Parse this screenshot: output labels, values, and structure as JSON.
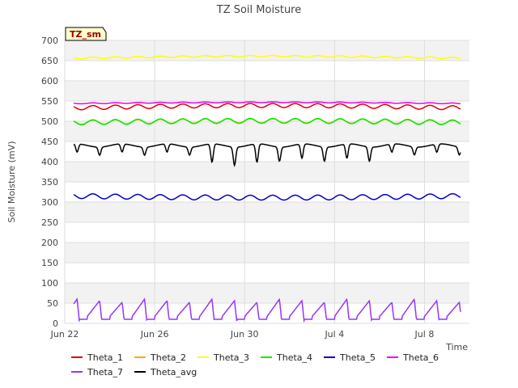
{
  "chart_data": {
    "type": "line",
    "title": "TZ Soil Moisture",
    "xlabel": "Time",
    "ylabel": "Soil Moisture (mV)",
    "badge": "TZ_sm",
    "ylim": [
      0,
      700
    ],
    "yticks": [
      0,
      50,
      100,
      150,
      200,
      250,
      300,
      350,
      400,
      450,
      500,
      550,
      600,
      650,
      700
    ],
    "xlim_days": [
      0,
      18
    ],
    "xticks": [
      {
        "label": "Jun 22",
        "day": 0
      },
      {
        "label": "Jun 26",
        "day": 4
      },
      {
        "label": "Jun 30",
        "day": 8
      },
      {
        "label": "Jul 4",
        "day": 12
      },
      {
        "label": "Jul 8",
        "day": 16
      }
    ],
    "data_range_days": [
      0.4,
      17.6
    ],
    "grid": true,
    "legend_position": "bottom",
    "series": [
      {
        "name": "Theta_1",
        "color": "#dd0000",
        "base": 533,
        "amp": 5,
        "trend": 6
      },
      {
        "name": "Theta_2",
        "color": "#ffaa00",
        "base": 497,
        "amp": 5,
        "trend": 4
      },
      {
        "name": "Theta_3",
        "color": "#ffff00",
        "base": 656,
        "amp": 2,
        "trend": 5
      },
      {
        "name": "Theta_4",
        "color": "#00ee00",
        "base": 497,
        "amp": 6,
        "trend": 4
      },
      {
        "name": "Theta_5",
        "color": "#0000cc",
        "base": 315,
        "amp": 6,
        "trend": -4
      },
      {
        "name": "Theta_6",
        "color": "#ee00ee",
        "base": 544,
        "amp": 1,
        "trend": 3
      },
      {
        "name": "Theta_7",
        "color": "#9933ff",
        "pattern": "sawtooth",
        "min": 5,
        "max": 60
      },
      {
        "name": "Theta_avg",
        "color": "#000000",
        "pattern": "dips",
        "high": 440,
        "low": 405
      }
    ]
  }
}
